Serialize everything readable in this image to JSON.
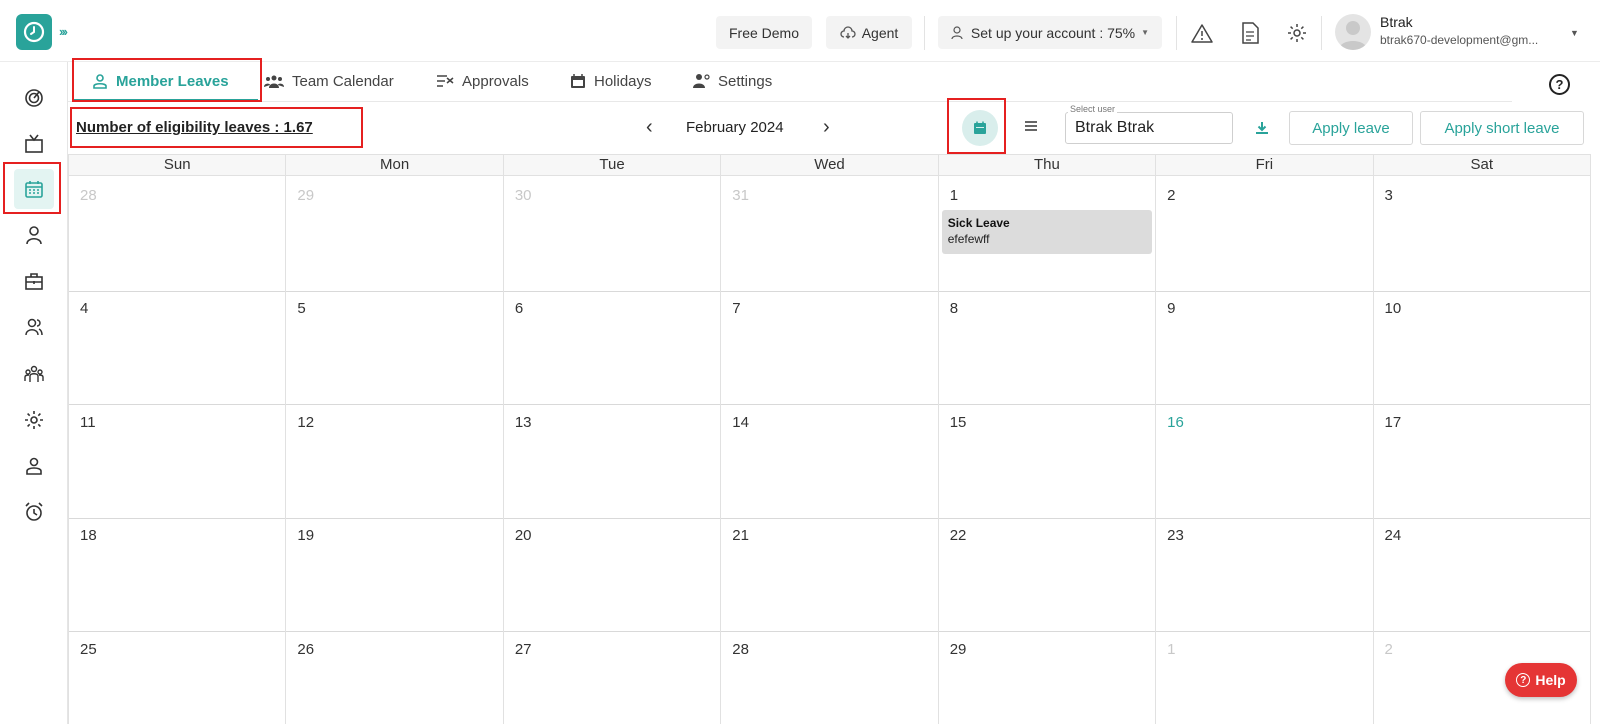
{
  "topbar": {
    "free_demo": "Free Demo",
    "agent": "Agent",
    "setup": "Set up your account : 75%",
    "user_name": "Btrak",
    "user_email": "btrak670-development@gm..."
  },
  "sidebar": {
    "items": [
      {
        "icon": "dashboard-icon"
      },
      {
        "icon": "tv-icon"
      },
      {
        "icon": "calendar-icon",
        "active": true
      },
      {
        "icon": "user-icon"
      },
      {
        "icon": "briefcase-icon"
      },
      {
        "icon": "users-icon"
      },
      {
        "icon": "team-icon"
      },
      {
        "icon": "settings-icon"
      },
      {
        "icon": "profile-icon"
      },
      {
        "icon": "alarm-icon"
      }
    ]
  },
  "tabs": {
    "member_leaves": "Member Leaves",
    "team_calendar": "Team Calendar",
    "approvals": "Approvals",
    "holidays": "Holidays",
    "settings": "Settings"
  },
  "toolbar": {
    "eligibility": "Number of eligibility leaves : 1.67",
    "month": "February 2024",
    "select_user_label": "Select user",
    "selected_user": "Btrak Btrak",
    "apply_leave": "Apply leave",
    "apply_short_leave": "Apply short leave"
  },
  "calendar": {
    "days_of_week": [
      "Sun",
      "Mon",
      "Tue",
      "Wed",
      "Thu",
      "Fri",
      "Sat"
    ],
    "weeks": [
      [
        {
          "n": "28",
          "o": true
        },
        {
          "n": "29",
          "o": true
        },
        {
          "n": "30",
          "o": true
        },
        {
          "n": "31",
          "o": true
        },
        {
          "n": "1"
        },
        {
          "n": "2"
        },
        {
          "n": "3"
        }
      ],
      [
        {
          "n": "4"
        },
        {
          "n": "5"
        },
        {
          "n": "6"
        },
        {
          "n": "7"
        },
        {
          "n": "8"
        },
        {
          "n": "9"
        },
        {
          "n": "10"
        }
      ],
      [
        {
          "n": "11"
        },
        {
          "n": "12"
        },
        {
          "n": "13"
        },
        {
          "n": "14"
        },
        {
          "n": "15"
        },
        {
          "n": "16",
          "t": true
        },
        {
          "n": "17"
        }
      ],
      [
        {
          "n": "18"
        },
        {
          "n": "19"
        },
        {
          "n": "20"
        },
        {
          "n": "21"
        },
        {
          "n": "22"
        },
        {
          "n": "23"
        },
        {
          "n": "24"
        }
      ],
      [
        {
          "n": "25"
        },
        {
          "n": "26"
        },
        {
          "n": "27"
        },
        {
          "n": "28"
        },
        {
          "n": "29"
        },
        {
          "n": "1",
          "o": true
        },
        {
          "n": "2",
          "o": true
        }
      ]
    ],
    "event": {
      "title": "Sick Leave",
      "subtitle": "efefewff"
    }
  },
  "help": {
    "label": "Help"
  },
  "colors": {
    "accent": "#29a39a",
    "highlight": "#e52020",
    "help": "#e53535"
  }
}
